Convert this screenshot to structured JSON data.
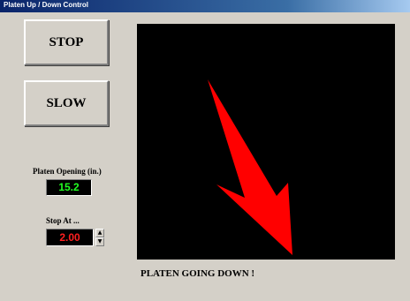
{
  "window": {
    "title": "Platen Up / Down Control"
  },
  "buttons": {
    "stop": "STOP",
    "slow": "SLOW"
  },
  "platen_opening": {
    "label": "Platen Opening (in.)",
    "value": "15.2",
    "value_color": "#22ff22"
  },
  "stop_at": {
    "label": "Stop At ...",
    "value": "2.00",
    "value_color": "#ff2020"
  },
  "direction_display": {
    "icon": "arrow-down-right-icon",
    "arrow_color": "#ff0000",
    "background": "#000000"
  },
  "status": {
    "text": "PLATEN GOING DOWN !"
  }
}
